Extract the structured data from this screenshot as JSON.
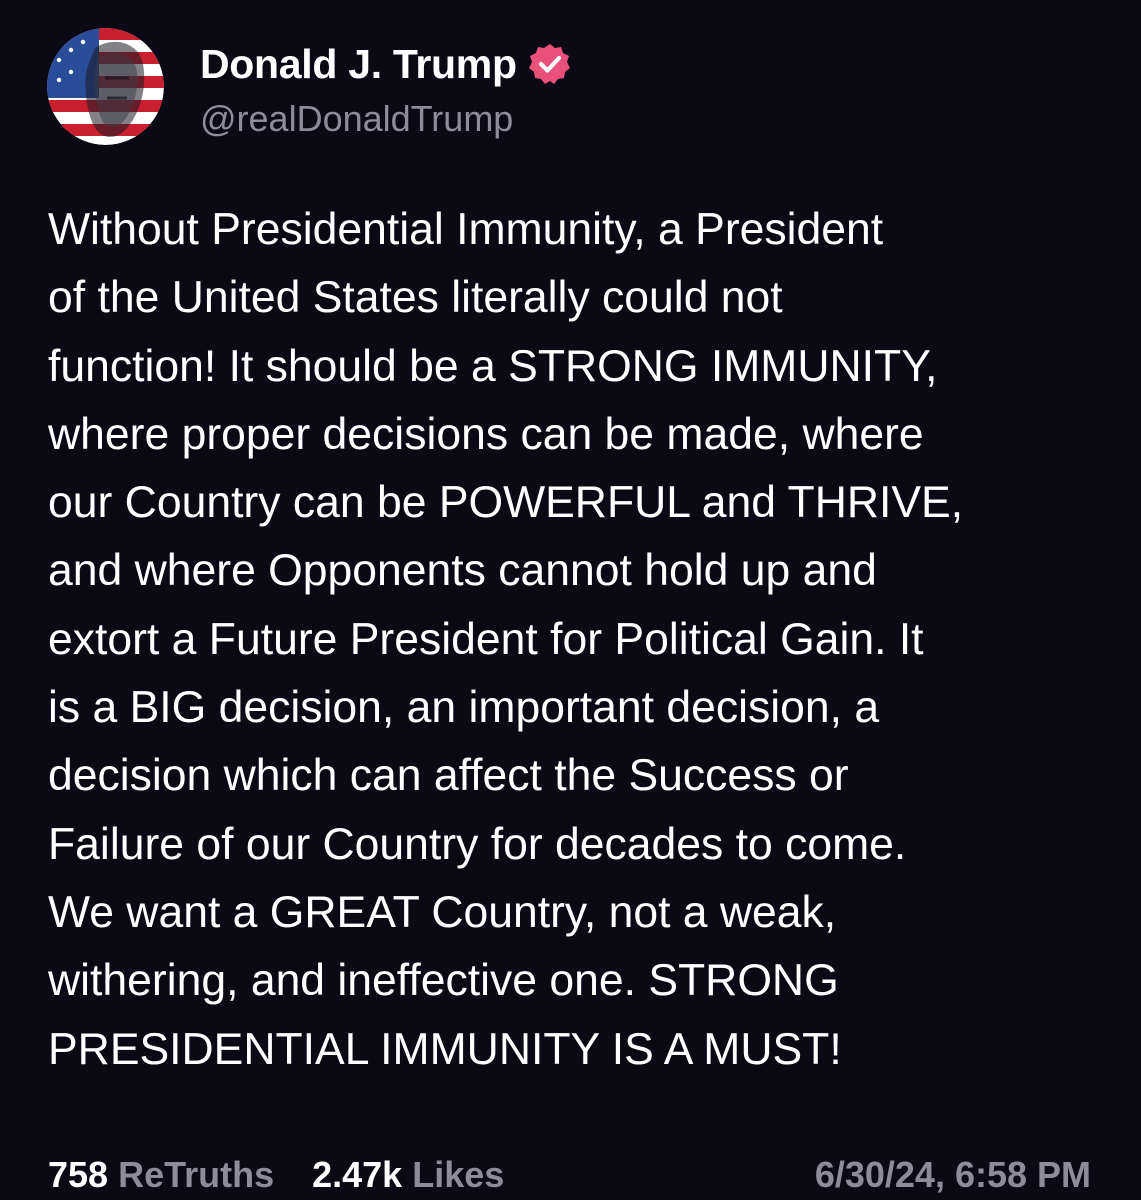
{
  "author": {
    "display_name": "Donald J. Trump",
    "handle": "@realDonaldTrump",
    "avatar_icon": "flag-portrait-avatar",
    "verified_icon": "verified-badge-icon",
    "verified_color": "#e9517a"
  },
  "post": {
    "lines": [
      "Without Presidential Immunity, a President",
      "of the United States literally could not",
      "function! It should be a STRONG IMMUNITY,",
      "where proper decisions can be made, where",
      "our Country can be POWERFUL and THRIVE,",
      "and where Opponents cannot hold up and",
      "extort a Future President for Political Gain. It",
      "is a BIG decision, an important decision, a",
      "decision which can affect the Success or",
      "Failure of our Country for decades to come.",
      "We want a GREAT Country, not a weak,",
      "withering, and ineffective one. STRONG",
      "PRESIDENTIAL IMMUNITY IS A MUST!"
    ]
  },
  "stats": {
    "retruths_count": "758",
    "retruths_label": "ReTruths",
    "likes_count": "2.47k",
    "likes_label": "Likes"
  },
  "timestamp": "6/30/24, 6:58 PM",
  "colors": {
    "background": "#0c0917",
    "text": "#ffffff",
    "muted": "#8e8b9c"
  }
}
